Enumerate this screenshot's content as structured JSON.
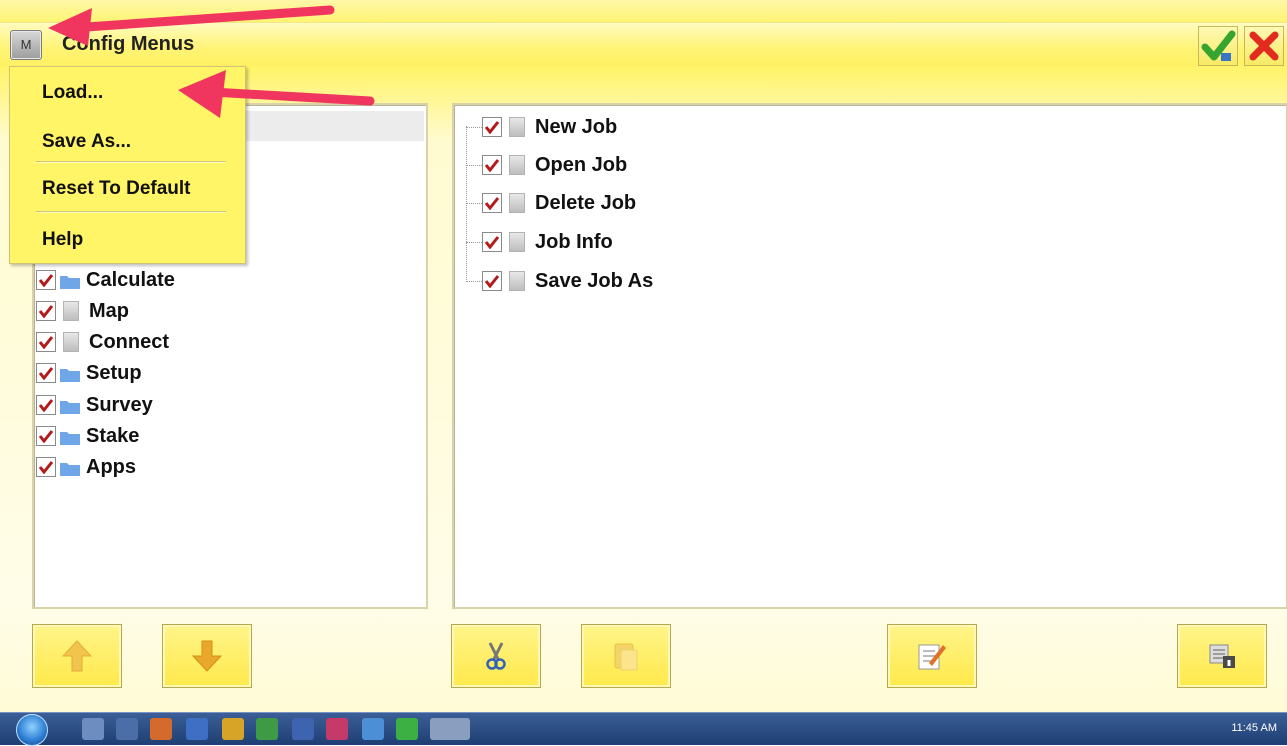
{
  "window": {
    "title": "Config Menus",
    "menu_button_label": "M"
  },
  "dropdown": {
    "items": [
      {
        "label": "Load..."
      },
      {
        "label": "Save As..."
      },
      {
        "label": "Reset To Default"
      },
      {
        "label": "Help"
      }
    ]
  },
  "left_tree": {
    "items": [
      {
        "label": "Calculate",
        "checked": true,
        "icon": "folder-icon"
      },
      {
        "label": "Map",
        "checked": true,
        "icon": "document-icon"
      },
      {
        "label": "Connect",
        "checked": true,
        "icon": "document-icon"
      },
      {
        "label": "Setup",
        "checked": true,
        "icon": "folder-icon"
      },
      {
        "label": "Survey",
        "checked": true,
        "icon": "folder-icon"
      },
      {
        "label": "Stake",
        "checked": true,
        "icon": "folder-icon"
      },
      {
        "label": "Apps",
        "checked": true,
        "icon": "folder-icon"
      }
    ]
  },
  "right_tree": {
    "items": [
      {
        "label": "New Job",
        "checked": true,
        "icon": "document-icon"
      },
      {
        "label": "Open Job",
        "checked": true,
        "icon": "document-icon"
      },
      {
        "label": "Delete Job",
        "checked": true,
        "icon": "document-icon"
      },
      {
        "label": "Job Info",
        "checked": true,
        "icon": "document-icon"
      },
      {
        "label": "Save Job As",
        "checked": true,
        "icon": "document-icon"
      }
    ]
  },
  "toolbar": {
    "buttons": [
      "move-up-icon",
      "move-down-icon",
      "cut-icon",
      "paste-icon",
      "edit-icon",
      "properties-icon"
    ]
  },
  "taskbar": {
    "clock": "11:45 AM"
  },
  "colors": {
    "accent_yellow": "#fff46b",
    "annotation_arrow": "#f0365f",
    "checkmark": "#b31b1b"
  }
}
